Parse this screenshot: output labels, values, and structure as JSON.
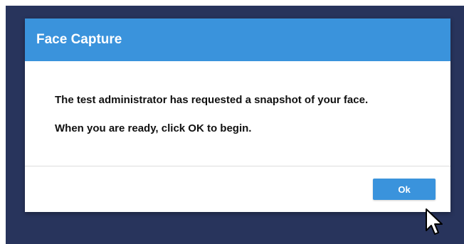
{
  "dialog": {
    "title": "Face Capture",
    "message_line_1": "The test administrator has requested a snapshot of your face.",
    "message_line_2": "When you are ready, click OK to begin.",
    "ok_label": "Ok"
  },
  "colors": {
    "background": "#28345c",
    "accent": "#3a93dc",
    "dialog_bg": "#ffffff"
  },
  "icons": {
    "cursor": "mouse-pointer-icon"
  }
}
